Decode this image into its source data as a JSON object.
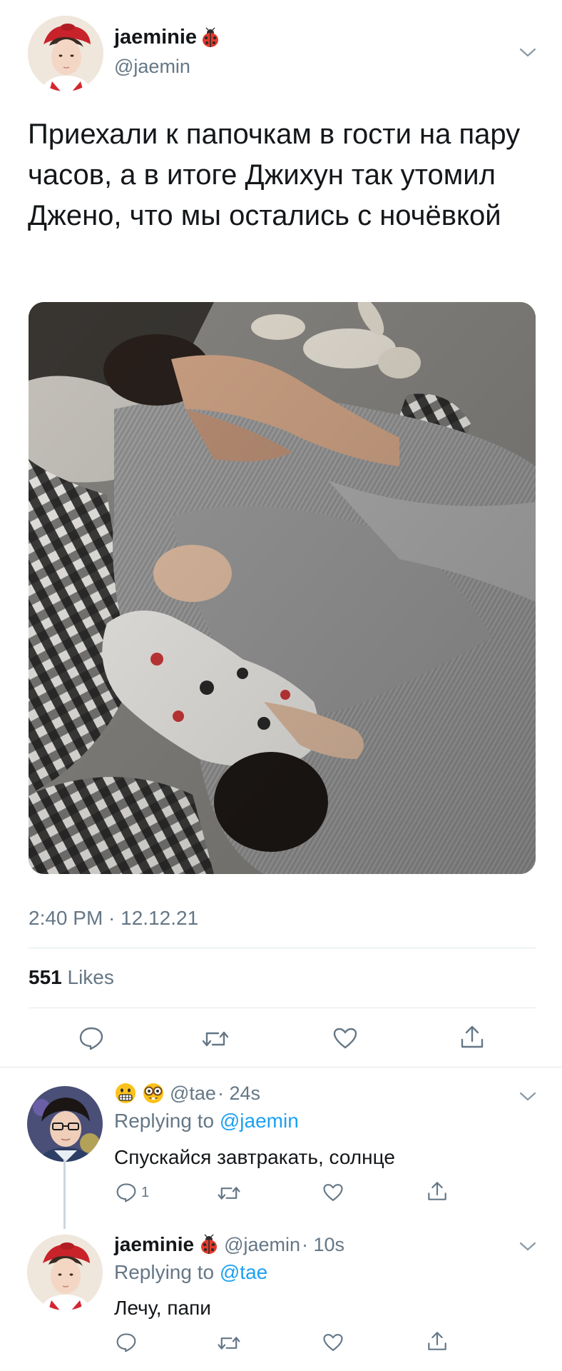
{
  "main_tweet": {
    "author_name": "jaeminie",
    "author_handle": "@jaemin",
    "text": "Приехали к папочкам в гости на пару часов, а в итоге Джихун так утомил Джено, что мы остались с ночёвкой",
    "timestamp": "2:40 PM · 12.12.21",
    "likes_count": "551",
    "likes_label": "Likes"
  },
  "replies": [
    {
      "author_handle": "@tae",
      "time": "· 24s",
      "replying_prefix": "Replying to",
      "replying_to": "@jaemin",
      "text": "Спускайся завтракать, солнце",
      "reply_count": "1"
    },
    {
      "author_name": "jaeminie",
      "author_handle": "@jaemin",
      "time": "· 10s",
      "replying_prefix": "Replying to",
      "replying_to": "@tae",
      "text": "Лечу, папи",
      "reply_count": ""
    }
  ],
  "icons": {
    "reply": "reply-icon",
    "retweet": "retweet-icon",
    "like": "heart-icon",
    "share": "share-icon",
    "more": "chevron-down-icon",
    "ladybug": "ladybug-emoji",
    "grimace": "grimacing-face-emoji",
    "nerd": "nerd-face-emoji"
  },
  "colors": {
    "text": "#14171a",
    "secondary": "#657786",
    "link": "#1da1f2",
    "divider": "#e1e8ed"
  }
}
